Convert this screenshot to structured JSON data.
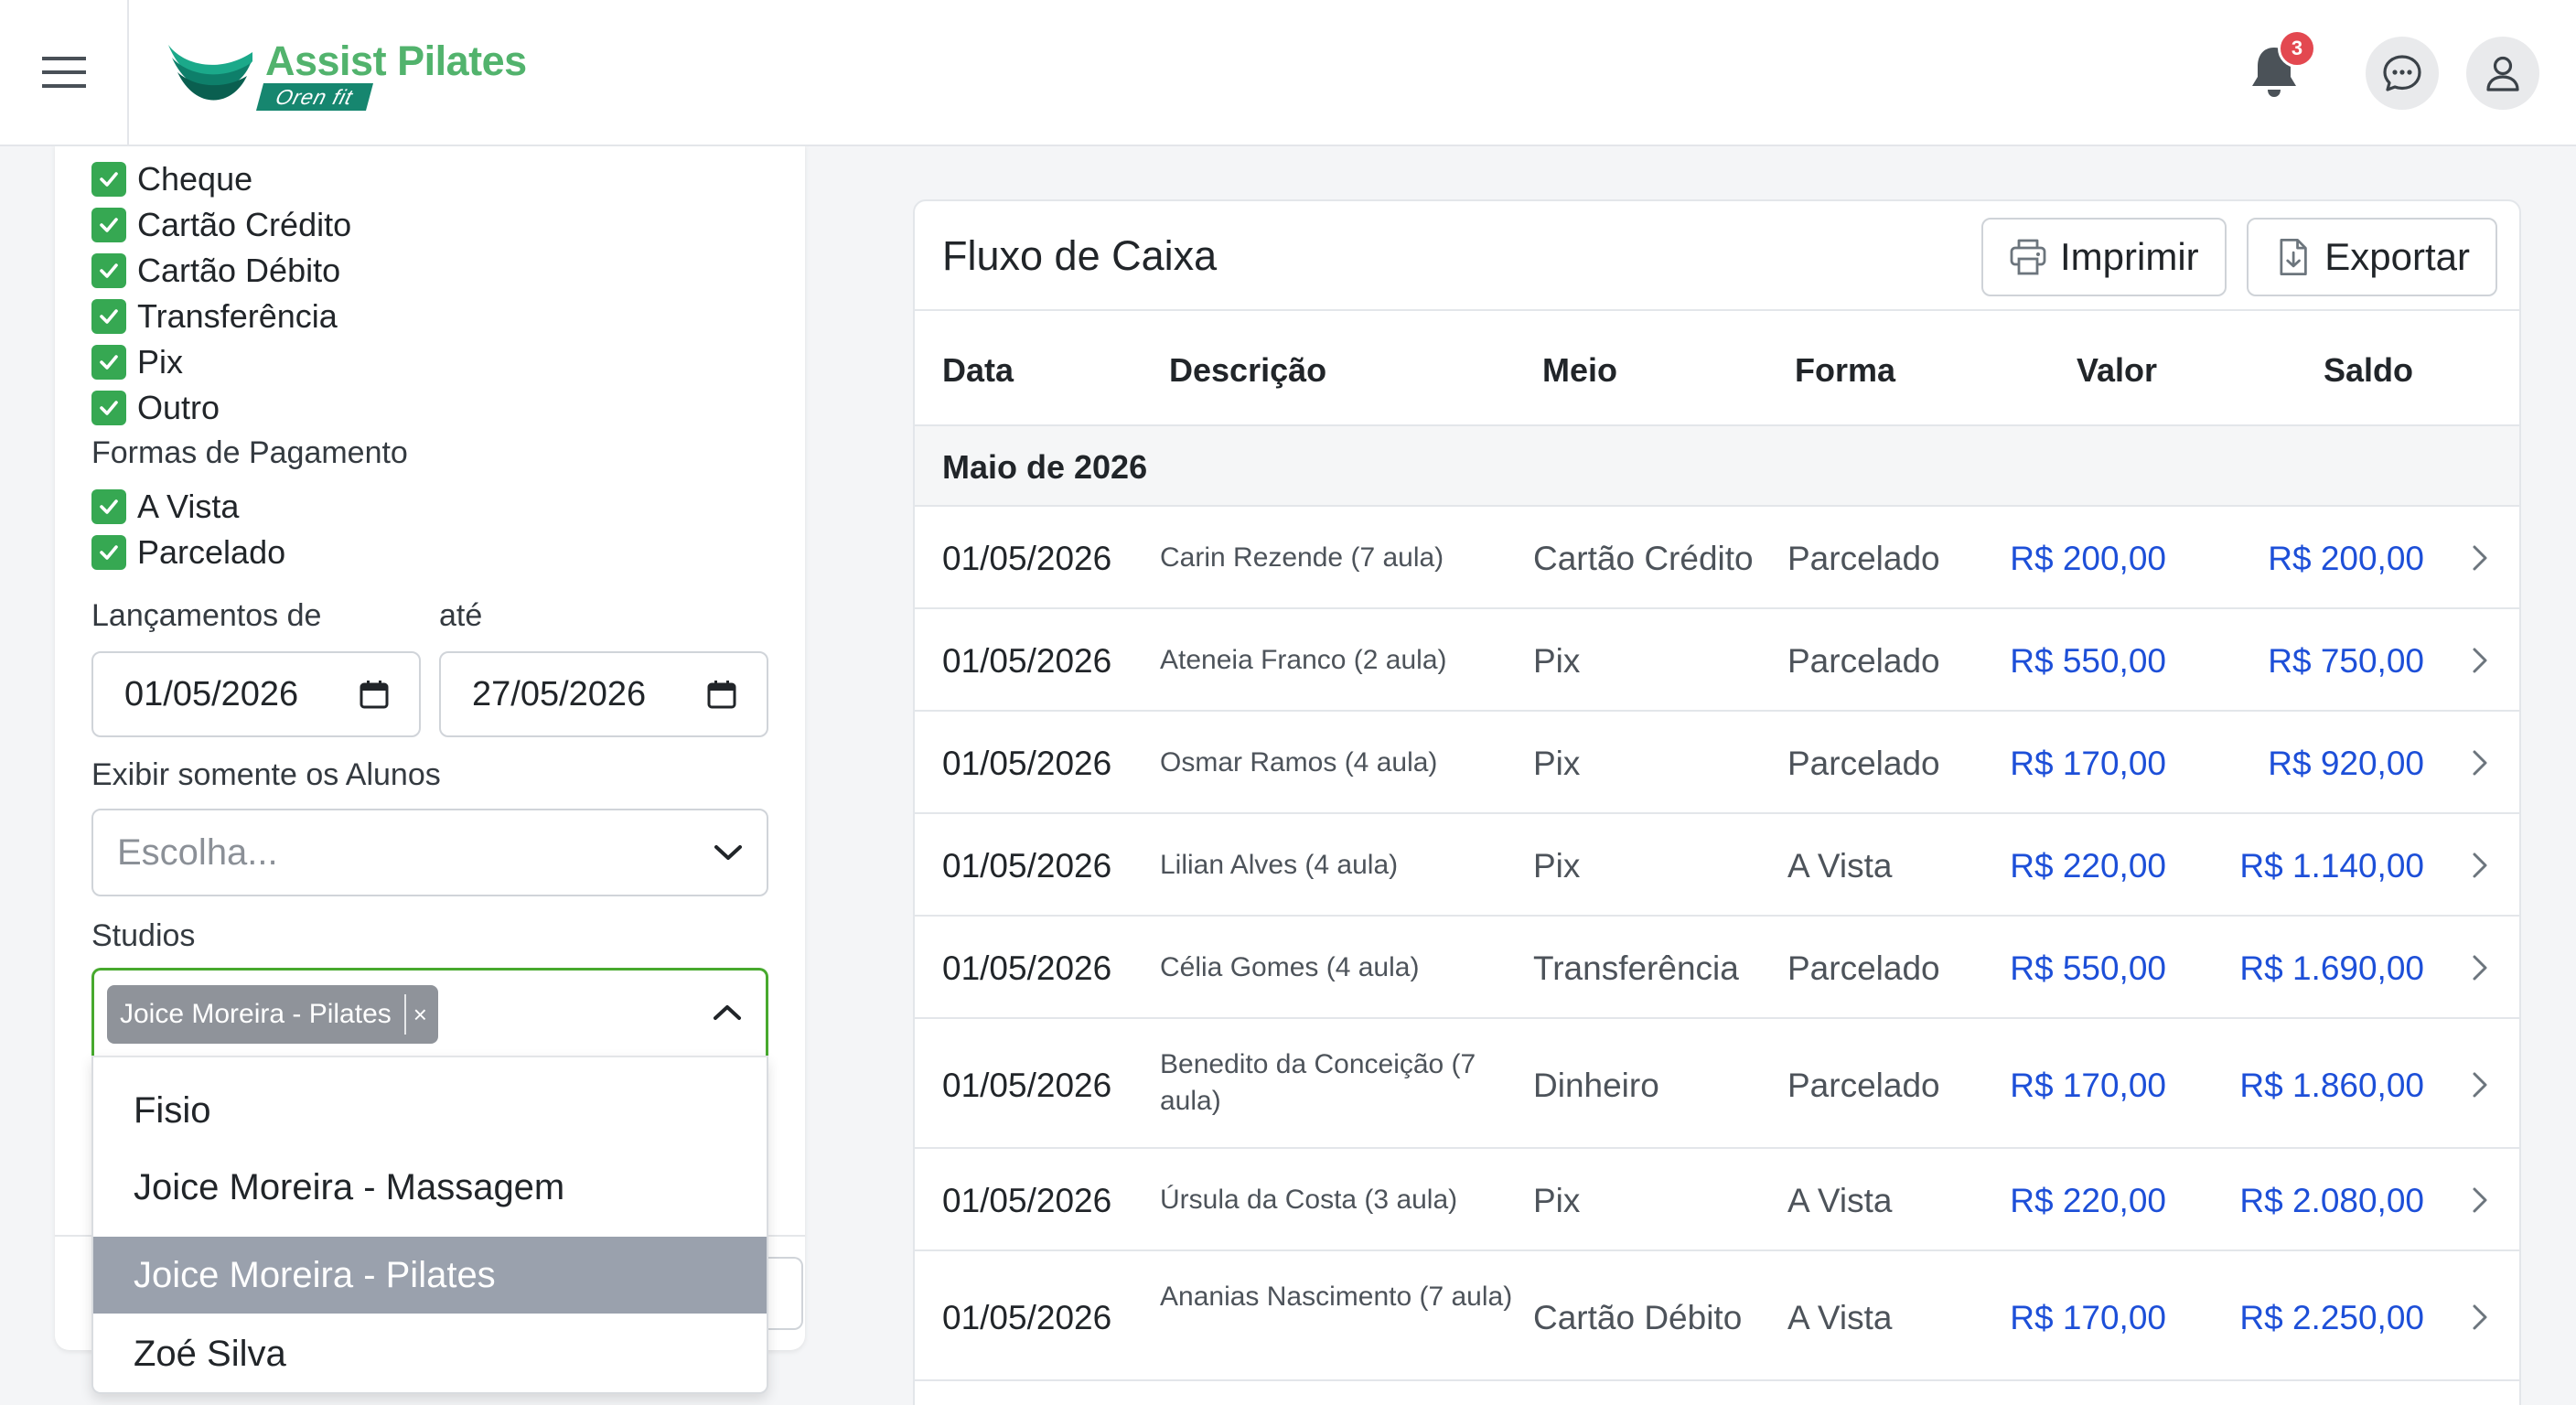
{
  "header": {
    "logo_title": "Assist Pilates",
    "logo_subtitle": "Oren fit",
    "notification_count": "3",
    "brand_color": "#52b36d",
    "accent_color": "#16866f"
  },
  "filters": {
    "payment_methods": [
      {
        "label": "Cheque",
        "checked": true
      },
      {
        "label": "Cartão Crédito",
        "checked": true
      },
      {
        "label": "Cartão Débito",
        "checked": true
      },
      {
        "label": "Transferência",
        "checked": true
      },
      {
        "label": "Pix",
        "checked": true
      },
      {
        "label": "Outro",
        "checked": true
      }
    ],
    "payment_forms_label": "Formas de Pagamento",
    "payment_forms": [
      {
        "label": "A Vista",
        "checked": true
      },
      {
        "label": "Parcelado",
        "checked": true
      }
    ],
    "date_from_label": "Lançamentos de",
    "date_to_label": "até",
    "date_from": "01/05/2026",
    "date_to": "27/05/2026",
    "students_label": "Exibir somente os Alunos",
    "students_placeholder": "Escolha...",
    "studios_label": "Studios",
    "studio_selected_chip": "Joice Moreira - Pilates",
    "studio_chip_remove": "×",
    "studio_options": [
      {
        "label": "Fisio",
        "selected": false
      },
      {
        "label": "Joice Moreira - Massagem",
        "selected": false
      },
      {
        "label": "Joice Moreira - Pilates",
        "selected": true
      },
      {
        "label": "Zoé Silva",
        "selected": false
      }
    ]
  },
  "cashflow": {
    "title": "Fluxo de Caixa",
    "print_label": "Imprimir",
    "export_label": "Exportar",
    "columns": {
      "data": "Data",
      "descricao": "Descrição",
      "meio": "Meio",
      "forma": "Forma",
      "valor": "Valor",
      "saldo": "Saldo"
    },
    "month_group": "Maio de 2026",
    "rows": [
      {
        "date": "01/05/2026",
        "description": "Carin Rezende (7 aula)",
        "meio": "Cartão Crédito",
        "forma": "Parcelado",
        "valor": "R$ 200,00",
        "saldo": "R$ 200,00"
      },
      {
        "date": "01/05/2026",
        "description": "Ateneia Franco (2 aula)",
        "meio": "Pix",
        "forma": "Parcelado",
        "valor": "R$ 550,00",
        "saldo": "R$ 750,00"
      },
      {
        "date": "01/05/2026",
        "description": "Osmar Ramos (4 aula)",
        "meio": "Pix",
        "forma": "Parcelado",
        "valor": "R$ 170,00",
        "saldo": "R$ 920,00"
      },
      {
        "date": "01/05/2026",
        "description": "Lilian Alves (4 aula)",
        "meio": "Pix",
        "forma": "A Vista",
        "valor": "R$ 220,00",
        "saldo": "R$ 1.140,00"
      },
      {
        "date": "01/05/2026",
        "description": "Célia Gomes (4 aula)",
        "meio": "Transferência",
        "forma": "Parcelado",
        "valor": "R$ 550,00",
        "saldo": "R$ 1.690,00"
      },
      {
        "date": "01/05/2026",
        "description": "Benedito da Conceição (7 aula)",
        "meio": "Dinheiro",
        "forma": "Parcelado",
        "valor": "R$ 170,00",
        "saldo": "R$ 1.860,00"
      },
      {
        "date": "01/05/2026",
        "description": "Úrsula da Costa (3 aula)",
        "meio": "Pix",
        "forma": "A Vista",
        "valor": "R$ 220,00",
        "saldo": "R$ 2.080,00"
      },
      {
        "date": "01/05/2026",
        "description": "Ananias Nascimento (7 aula)",
        "meio": "Cartão Débito",
        "forma": "A Vista",
        "valor": "R$ 170,00",
        "saldo": "R$ 2.250,00"
      }
    ],
    "value_color": "#1d4fd8"
  }
}
